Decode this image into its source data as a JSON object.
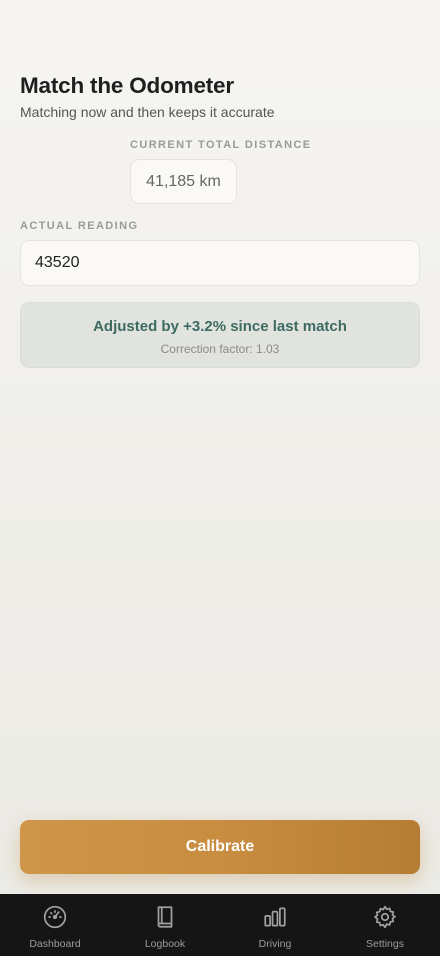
{
  "header": {
    "title": "Match the Odometer",
    "subtitle": "Matching now and then keeps it accurate"
  },
  "current_distance": {
    "label": "CURRENT TOTAL DISTANCE",
    "value": "41,185 km"
  },
  "actual_reading": {
    "label": "ACTUAL READING",
    "value": "43520"
  },
  "adjustment": {
    "headline": "Adjusted by +3.2% since last match",
    "detail": "Correction factor: 1.03"
  },
  "calibrate_button": {
    "label": "Calibrate"
  },
  "colors": {
    "accent": "#c88d40",
    "positive_text": "#3d6b62",
    "tab_bar": "#151515"
  },
  "tabs": [
    {
      "label": "Dashboard",
      "icon": "gauge-icon"
    },
    {
      "label": "Logbook",
      "icon": "book-icon"
    },
    {
      "label": "Driving",
      "icon": "bar-chart-icon"
    },
    {
      "label": "Settings",
      "icon": "gear-icon"
    }
  ]
}
